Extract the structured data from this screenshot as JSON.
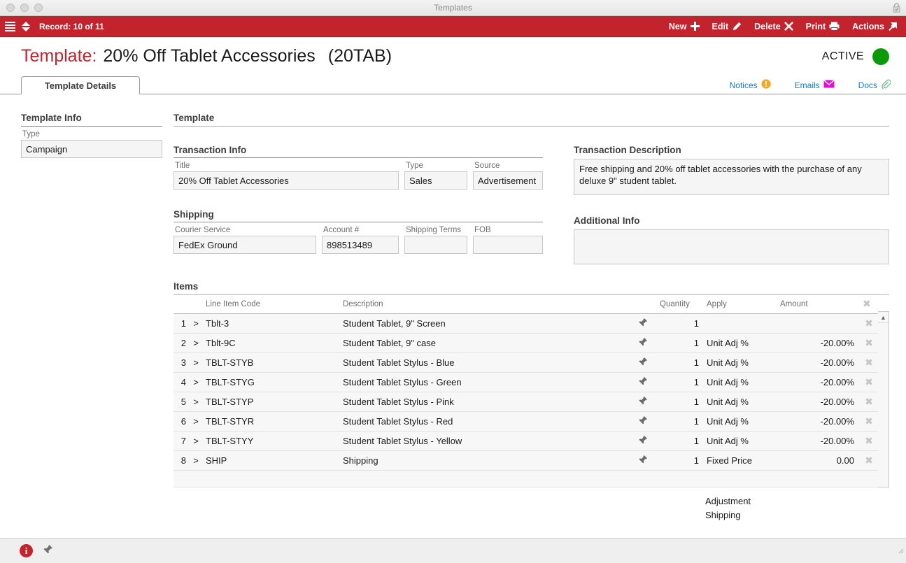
{
  "window": {
    "title": "Templates",
    "lock_icon": "lock-icon"
  },
  "toolbar": {
    "menu_icon": "hamburger-menu-icon",
    "nav_icon": "record-nav-updown-icon",
    "record_label": "Record: 10 of 11",
    "buttons": [
      {
        "label": "New",
        "icon": "plus-icon"
      },
      {
        "label": "Edit",
        "icon": "pencil-icon"
      },
      {
        "label": "Delete",
        "icon": "x-cross-icon"
      },
      {
        "label": "Print",
        "icon": "printer-icon"
      },
      {
        "label": "Actions",
        "icon": "arrow-out-icon"
      }
    ]
  },
  "header": {
    "label": "Template:",
    "title": "20% Off Tablet Accessories",
    "code": "(20TAB)",
    "status_text": "ACTIVE",
    "status_color": "#0a9a0a",
    "accent_color": "#c3232d"
  },
  "tabs": [
    {
      "label": "Template Details",
      "active": true
    }
  ],
  "tab_links": [
    {
      "label": "Notices",
      "icon": "warning-icon"
    },
    {
      "label": "Emails",
      "icon": "envelope-icon"
    },
    {
      "label": "Docs",
      "icon": "paperclip-icon"
    }
  ],
  "sidebar": {
    "section_title": "Template Info",
    "fields": [
      {
        "label": "Type",
        "value": "Campaign"
      }
    ]
  },
  "main": {
    "section_title": "Template",
    "transaction_info": {
      "title": "Transaction Info",
      "fields": [
        {
          "label": "Title",
          "value": "20% Off Tablet Accessories"
        },
        {
          "label": "Type",
          "value": "Sales"
        },
        {
          "label": "Source",
          "value": "Advertisement"
        }
      ]
    },
    "shipping": {
      "title": "Shipping",
      "fields": [
        {
          "label": "Courier Service",
          "value": "FedEx Ground"
        },
        {
          "label": "Account #",
          "value": "898513489"
        },
        {
          "label": "Shipping Terms",
          "value": ""
        },
        {
          "label": "FOB",
          "value": ""
        }
      ]
    },
    "transaction_description": {
      "title": "Transaction Description",
      "value": "Free shipping and 20% off tablet accessories with the purchase of any deluxe 9\" student tablet."
    },
    "additional_info": {
      "title": "Additional Info",
      "value": ""
    },
    "items": {
      "title": "Items",
      "columns": [
        "",
        "",
        "Line Item Code",
        "Description",
        "",
        "Quantity",
        "Apply",
        "Amount",
        ""
      ],
      "header_delete_icon": "x-delete-icon",
      "rows": [
        {
          "num": "1",
          "expand": ">",
          "code": "Tblt-3",
          "description": "Student Tablet, 9\" Screen",
          "pin": "pin-icon",
          "quantity": "1",
          "apply": "",
          "amount": "",
          "amount_negative": false
        },
        {
          "num": "2",
          "expand": ">",
          "code": "Tblt-9C",
          "description": "Student Tablet, 9\" case",
          "pin": "pin-icon",
          "quantity": "1",
          "apply": "Unit Adj %",
          "amount": "-20.00%",
          "amount_negative": true
        },
        {
          "num": "3",
          "expand": ">",
          "code": "TBLT-STYB",
          "description": "Student Tablet Stylus - Blue",
          "pin": "pin-icon",
          "quantity": "1",
          "apply": "Unit Adj %",
          "amount": "-20.00%",
          "amount_negative": true
        },
        {
          "num": "4",
          "expand": ">",
          "code": "TBLT-STYG",
          "description": "Student Tablet Stylus - Green",
          "pin": "pin-icon",
          "quantity": "1",
          "apply": "Unit Adj %",
          "amount": "-20.00%",
          "amount_negative": true
        },
        {
          "num": "5",
          "expand": ">",
          "code": "TBLT-STYP",
          "description": "Student Tablet Stylus - Pink",
          "pin": "pin-icon",
          "quantity": "1",
          "apply": "Unit Adj %",
          "amount": "-20.00%",
          "amount_negative": true
        },
        {
          "num": "6",
          "expand": ">",
          "code": "TBLT-STYR",
          "description": "Student Tablet Stylus - Red",
          "pin": "pin-icon",
          "quantity": "1",
          "apply": "Unit Adj %",
          "amount": "-20.00%",
          "amount_negative": true
        },
        {
          "num": "7",
          "expand": ">",
          "code": "TBLT-STYY",
          "description": "Student Tablet Stylus - Yellow",
          "pin": "pin-icon",
          "quantity": "1",
          "apply": "Unit Adj %",
          "amount": "-20.00%",
          "amount_negative": true
        },
        {
          "num": "8",
          "expand": ">",
          "code": "SHIP",
          "description": "Shipping",
          "pin": "pin-icon",
          "quantity": "1",
          "apply": "Fixed Price",
          "amount": "0.00",
          "amount_negative": false
        }
      ],
      "row_delete_icon": "x-delete-icon",
      "scroll_up_icon": "chevron-up-icon"
    },
    "totals": [
      {
        "label": "Adjustment"
      },
      {
        "label": "Shipping"
      }
    ]
  },
  "statusbar": {
    "info_icon": "info-icon",
    "info_glyph": "i",
    "pin_icon": "pin-icon"
  }
}
